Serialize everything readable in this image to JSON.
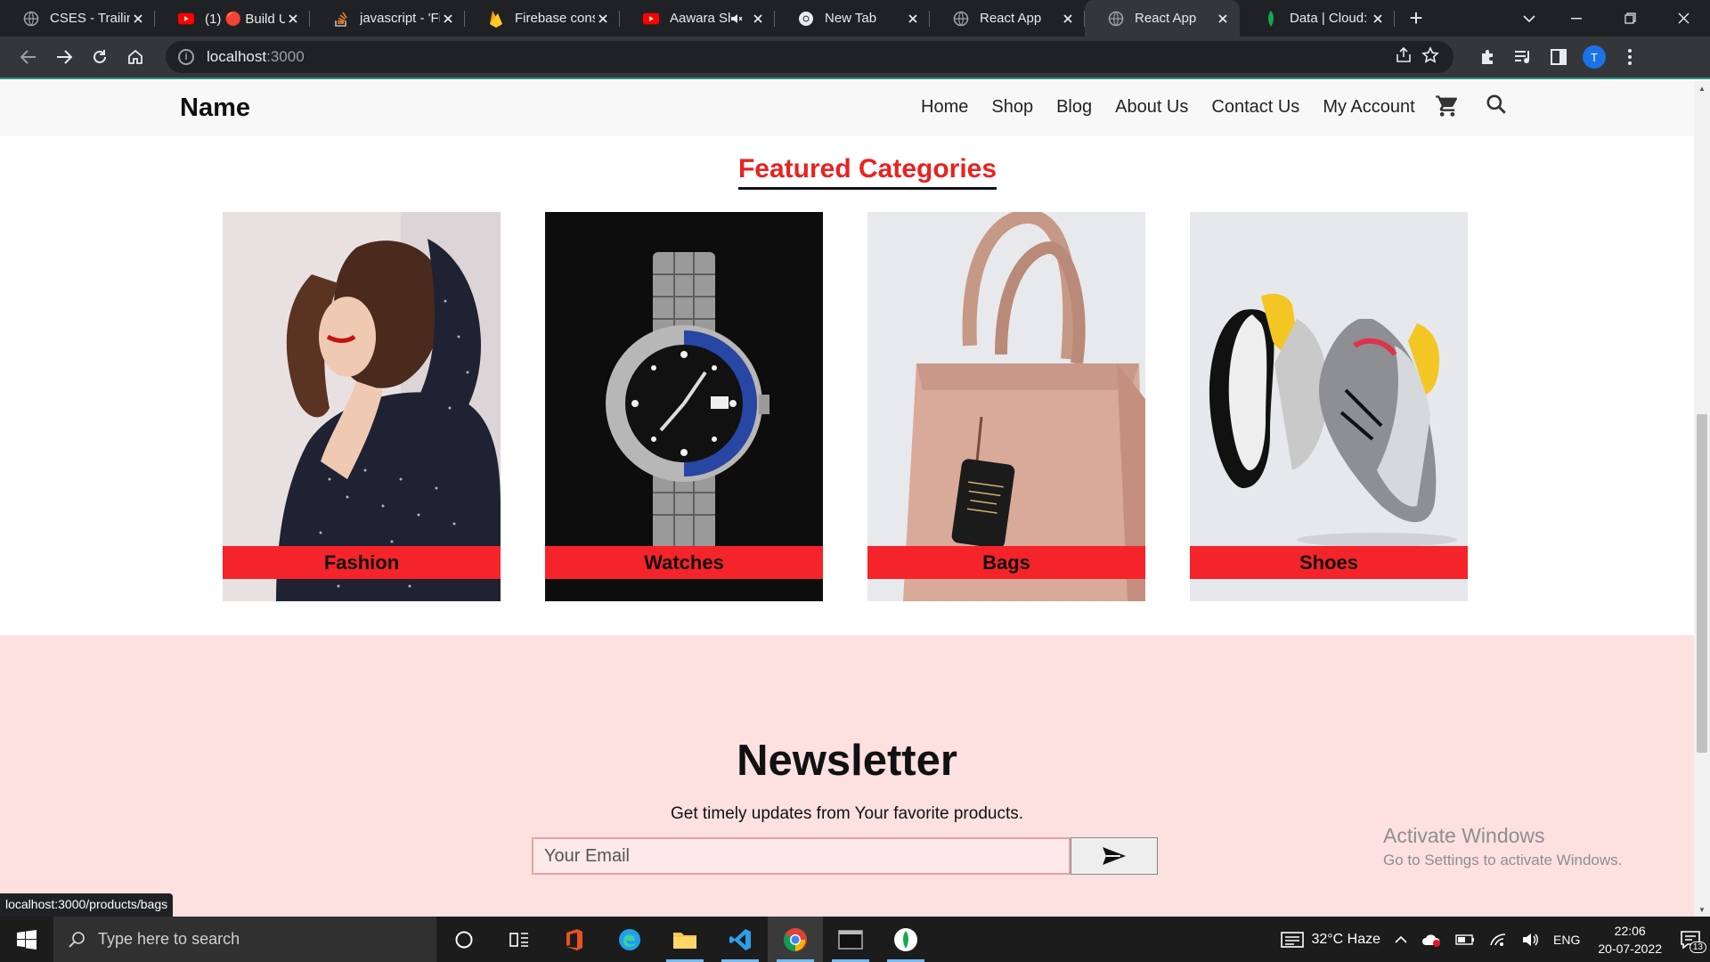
{
  "browser": {
    "tabs": [
      {
        "title": "CSES - Trailing",
        "icon": "globe-icon"
      },
      {
        "title": "(1) 🔴 Build U",
        "icon": "youtube-icon"
      },
      {
        "title": "javascript - 'Fi",
        "icon": "stackoverflow-icon"
      },
      {
        "title": "Firebase consc",
        "icon": "firebase-icon"
      },
      {
        "title": "Aawara Sh",
        "icon": "youtube-icon",
        "muted": true
      },
      {
        "title": "New Tab",
        "icon": "chrome-icon"
      },
      {
        "title": "React App",
        "icon": "globe-icon"
      },
      {
        "title": "React App",
        "icon": "globe-icon",
        "active": true
      },
      {
        "title": "Data | Cloud: I",
        "icon": "mongodb-icon"
      }
    ],
    "url_host": "localhost",
    "url_rest": ":3000",
    "profile_initial": "T",
    "status_link": "localhost:3000/products/bags"
  },
  "site": {
    "brand": "Name",
    "menu": [
      "Home",
      "Shop",
      "Blog",
      "About Us",
      "Contact Us",
      "My Account"
    ],
    "featured_title": "Featured Categories",
    "categories": [
      {
        "label": "Fashion"
      },
      {
        "label": "Watches"
      },
      {
        "label": "Bags"
      },
      {
        "label": "Shoes"
      }
    ],
    "newsletter": {
      "title": "Newsletter",
      "subtitle": "Get timely updates from Your favorite products.",
      "placeholder": "Your Email"
    }
  },
  "watermark": {
    "line1": "Activate Windows",
    "line2": "Go to Settings to activate Windows."
  },
  "taskbar": {
    "search_placeholder": "Type here to search",
    "weather": "32°C  Haze",
    "language": "ENG",
    "time": "22:06",
    "date": "20-07-2022",
    "notifications": "13"
  },
  "colors": {
    "accent_red": "#f5232a",
    "title_red": "#e8231f",
    "newsletter_bg": "#fde1e1"
  }
}
